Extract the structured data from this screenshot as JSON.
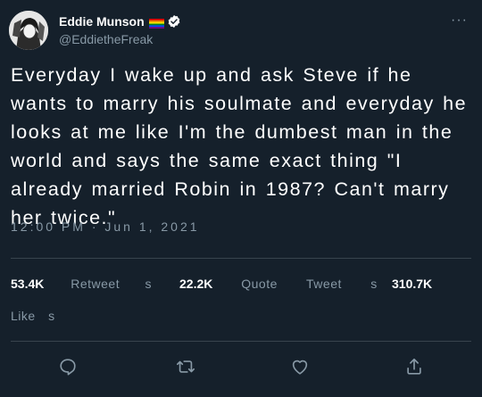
{
  "author": {
    "display_name": "Eddie Munson",
    "handle": "@EddietheFreak",
    "verified": true,
    "flag_icon": "rainbow-flag",
    "more_label": "···"
  },
  "tweet": {
    "text": "Everyday I wake up and ask Steve if he wants to marry his soulmate and everyday he looks at me like I'm the dumbest man in the world and says the same exact thing \"I already married Robin in 1987? Can't marry her twice.\"",
    "timestamp": "12:00 PM · Jun 1, 2021"
  },
  "stats": {
    "retweets": "53.4K",
    "retweets_label": "Retweet s",
    "quotes": "22.2K",
    "quotes_label": "Quote Tweet s",
    "likes": "310.7K",
    "likes_label": "Like s"
  },
  "colors": {
    "background": "#15202b",
    "secondary_text": "#8899a6",
    "divider": "#38444d"
  }
}
